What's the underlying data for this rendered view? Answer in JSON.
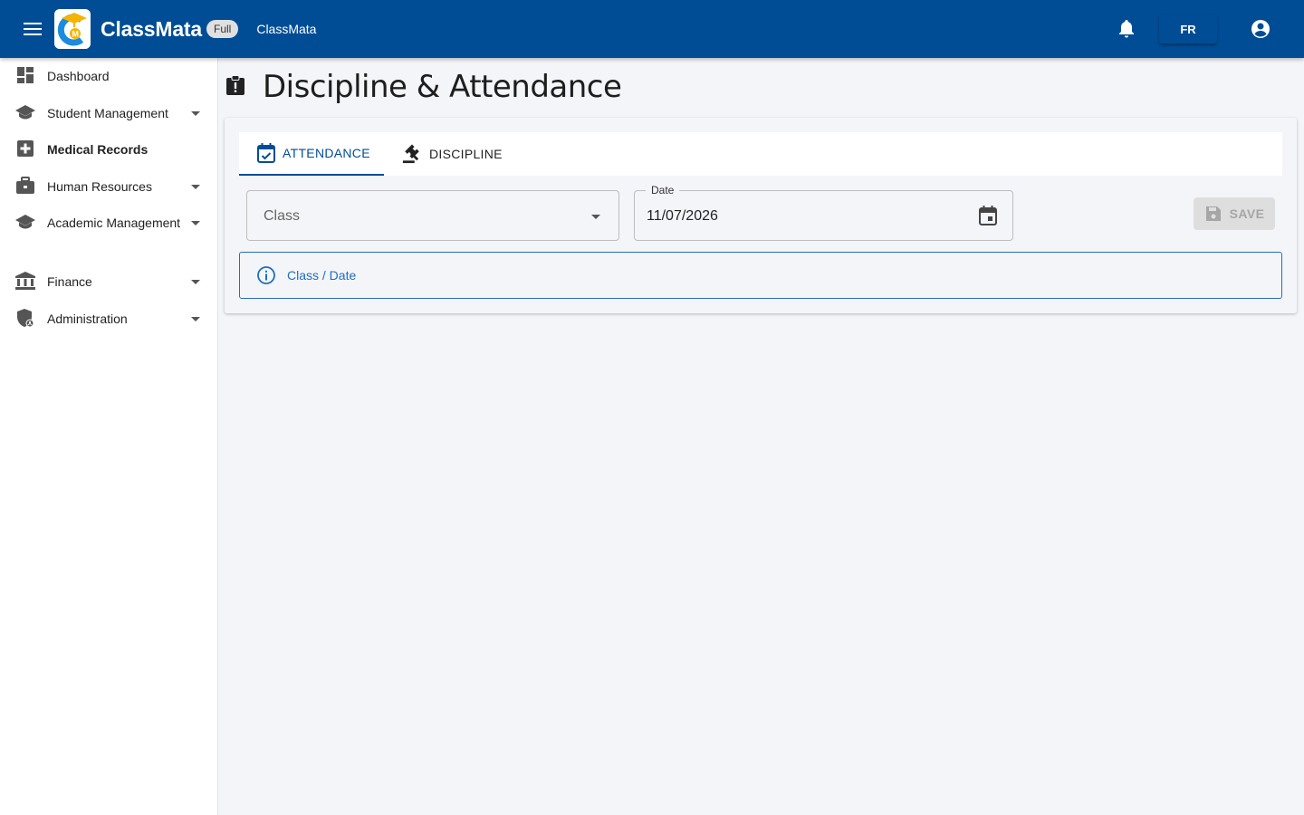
{
  "appbar": {
    "brand": "ClassMata",
    "badge": "Full",
    "subtitle": "ClassMata",
    "language": "FR"
  },
  "sidebar": {
    "items": [
      {
        "label": "Dashboard",
        "icon": "dashboard-icon",
        "expandable": false
      },
      {
        "label": "Student Management",
        "icon": "school-icon",
        "expandable": true
      },
      {
        "label": "Medical Records",
        "icon": "medical-icon",
        "expandable": false
      },
      {
        "label": "Human Resources",
        "icon": "briefcase-icon",
        "expandable": true
      },
      {
        "label": "Academic Management",
        "icon": "school-icon",
        "expandable": true
      },
      {
        "label": "Finance",
        "icon": "bank-icon",
        "expandable": true
      },
      {
        "label": "Administration",
        "icon": "admin-shield-icon",
        "expandable": true
      }
    ]
  },
  "page": {
    "title": "Discipline & Attendance"
  },
  "tabs": [
    {
      "label": "ATTENDANCE",
      "active": true
    },
    {
      "label": "DISCIPLINE",
      "active": false
    }
  ],
  "form": {
    "class_placeholder": "Class",
    "date_label": "Date",
    "date_value": "11/07/2026",
    "save_label": "SAVE"
  },
  "alert": {
    "message": "Class / Date"
  },
  "colors": {
    "primary": "#004d96",
    "background": "#f4f5f9",
    "info": "#1d6ec2",
    "logo_accent": "#f5b400"
  }
}
